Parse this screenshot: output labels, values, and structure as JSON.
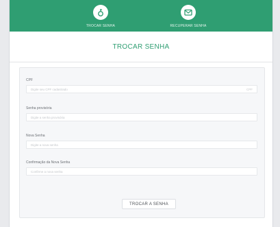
{
  "colors": {
    "brand": "#2f9e72",
    "background": "#e9eaed",
    "panel": "#f6f7f9"
  },
  "header": {
    "tabs": [
      {
        "label": "TROCAR SENHA",
        "icon": "key-icon"
      },
      {
        "label": "RECUPERAR SENHA",
        "icon": "mail-icon"
      }
    ]
  },
  "page": {
    "title": "TROCAR SENHA"
  },
  "form": {
    "fields": [
      {
        "label": "CPF",
        "placeholder": "Digite seu CPF cadastrado",
        "suffix": "CPF"
      },
      {
        "label": "Senha provisória",
        "placeholder": "Digite a senha provisória"
      },
      {
        "label": "Nova Senha",
        "placeholder": "Digite a nova senha"
      },
      {
        "label": "Confirmação da Nova Senha",
        "placeholder": "Confirme a nova senha"
      }
    ],
    "submit_label": "TROCAR A SENHA"
  }
}
